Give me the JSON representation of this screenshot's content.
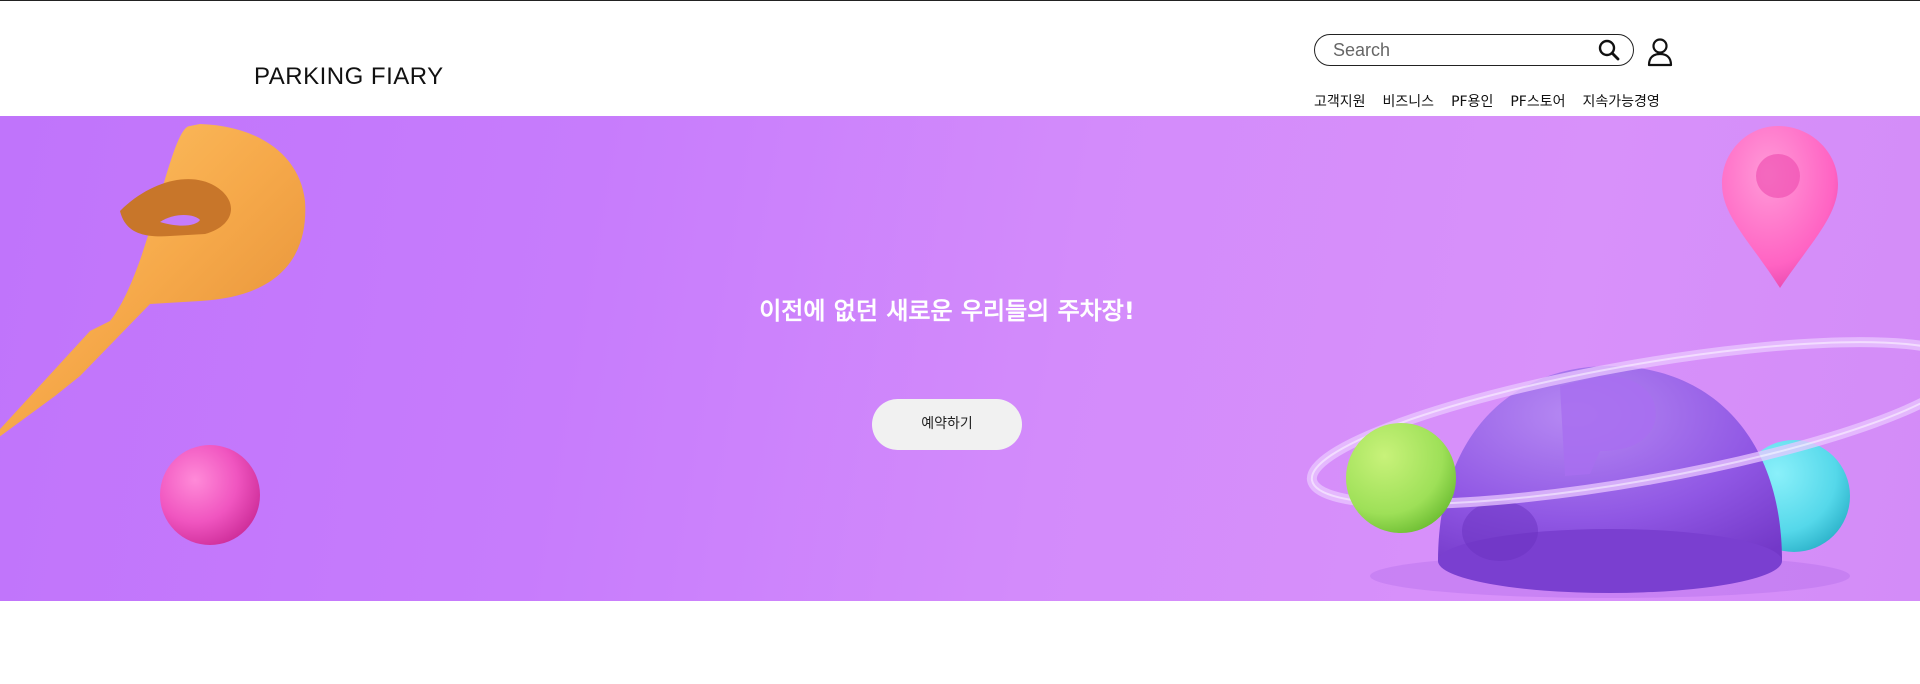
{
  "header": {
    "logo": "PARKING FIARY",
    "search": {
      "placeholder": "Search",
      "value": ""
    },
    "icons": {
      "search": "search-icon",
      "user": "user-icon"
    },
    "nav": [
      {
        "label": "고객지원"
      },
      {
        "label": "비즈니스"
      },
      {
        "label": "PF용인"
      },
      {
        "label": "PF스토어"
      },
      {
        "label": "지속가능경영"
      }
    ]
  },
  "hero": {
    "title": "이전에 없던 새로운 우리들의 주차장!",
    "cta_label": "예약하기",
    "colors": {
      "background_start": "#c074fb",
      "background_end": "#d891fa",
      "button_bg": "#f1f1f1",
      "title_color": "#ffffff"
    },
    "decorations": [
      "p-letter-3d",
      "pink-sphere",
      "location-pin",
      "parking-dome-planet",
      "green-sphere",
      "cyan-sphere",
      "ring"
    ]
  }
}
